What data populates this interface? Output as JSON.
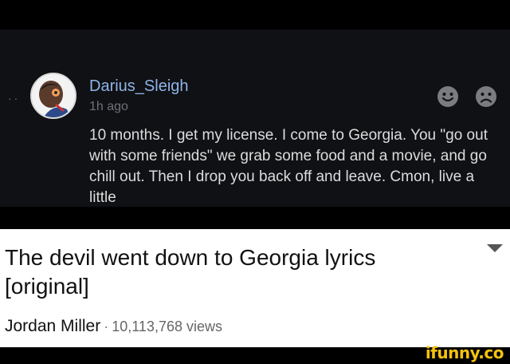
{
  "comment": {
    "username": "Darius_Sleigh",
    "time": "1h ago",
    "body": "10 months. I get my license. I come to Georgia. You \"go out with some friends\" we grab some food and a movie, and go chill out. Then I drop you back off and leave. Cmon, live a little",
    "reactions": [
      "happy-face-icon",
      "sad-face-icon"
    ]
  },
  "video": {
    "title": "The devil went down to Georgia lyrics [original]",
    "channel": "Jordan Miller",
    "separator": "·",
    "views": "10,113,768 views"
  },
  "watermark": "ifunny.co",
  "colors": {
    "username": "#8fb3e8",
    "comment_bg": "#101114",
    "watermark": "#f4c20d"
  }
}
